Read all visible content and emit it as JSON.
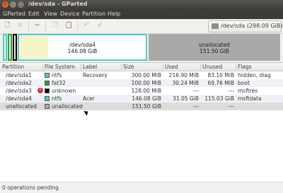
{
  "window": {
    "title": "/dev/sda - GParted"
  },
  "menu": [
    "GParted",
    "Edit",
    "View",
    "Device",
    "Partition",
    "Help"
  ],
  "toolbar": {
    "device_label": "/dev/sda",
    "device_size": "(298.09 GiB)"
  },
  "map": {
    "sda4_name": "/dev/sda4",
    "sda4_size": "146.08 GiB",
    "unalloc_name": "unallocated",
    "unalloc_size": "151.50 GiB",
    "colors": {
      "ntfs": "#4ccfc0",
      "fat32": "#2ba02b",
      "unknown": "#000000",
      "unallocated": "#a9a9a9",
      "used": "#f7f3c8"
    }
  },
  "table": {
    "headers": [
      "Partition",
      "File System",
      "Label",
      "Size",
      "Used",
      "Unused",
      "Flags"
    ],
    "rows": [
      {
        "partition": "/dev/sda1",
        "fs": "ntfs",
        "fs_color": "#4ccfc0",
        "label": "Recovery",
        "size": "300.00 MiB",
        "used": "216.90 MiB",
        "unused": "83.10 MiB",
        "flags": "hidden, diag"
      },
      {
        "partition": "/dev/sda2",
        "fs": "fat32",
        "fs_color": "#2ba02b",
        "label": "",
        "size": "100.00 MiB",
        "used": "30.24 MiB",
        "unused": "69.76 MiB",
        "flags": "boot"
      },
      {
        "partition": "/dev/sda3",
        "fs": "unknown",
        "fs_color": "#000000",
        "label": "",
        "size": "128.00 MiB",
        "used": "---",
        "unused": "---",
        "flags": "msftres"
      },
      {
        "partition": "/dev/sda4",
        "fs": "ntfs",
        "fs_color": "#4ccfc0",
        "label": "Acer",
        "size": "146.08 GiB",
        "used": "31.05 GiB",
        "unused": "115.03 GiB",
        "flags": "msftdata"
      },
      {
        "partition": "unallocated",
        "fs": "unallocated",
        "fs_color": "#a9a9a9",
        "label": "",
        "size": "151.50 GiB",
        "used": "---",
        "unused": "---",
        "flags": ""
      }
    ]
  },
  "status": {
    "text": "0 operations pending"
  }
}
